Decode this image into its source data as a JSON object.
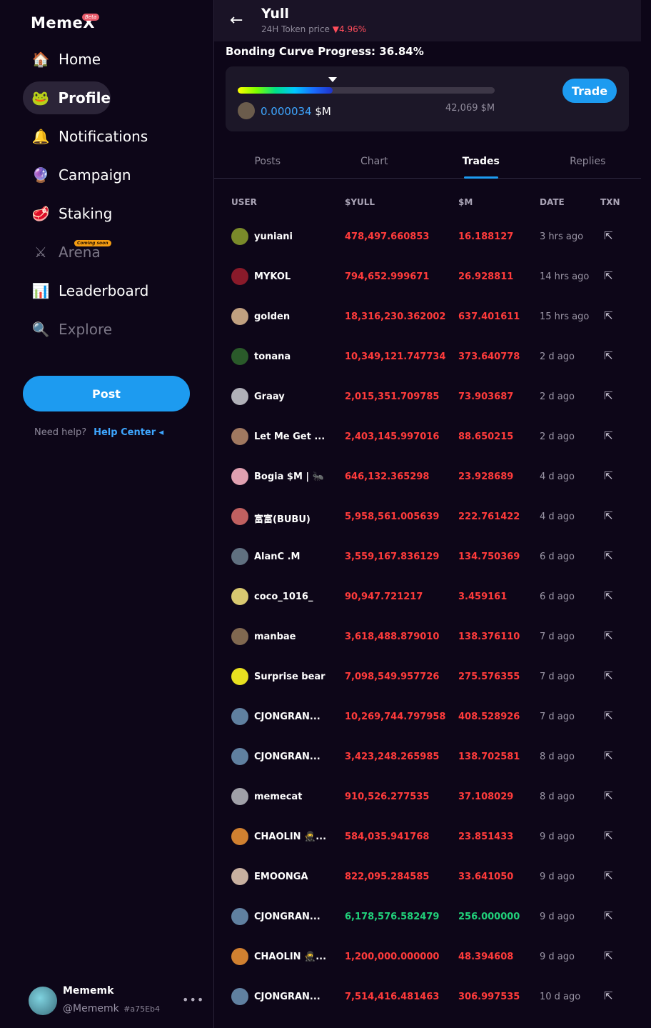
{
  "sidebar": {
    "logo": "MemeX",
    "beta": "Beta",
    "nav": [
      {
        "label": "Home",
        "icon": "🏠"
      },
      {
        "label": "Profile",
        "icon": "🐸"
      },
      {
        "label": "Notifications",
        "icon": "🔔"
      },
      {
        "label": "Campaign",
        "icon": "🔮"
      },
      {
        "label": "Staking",
        "icon": "🥩"
      },
      {
        "label": "Arena",
        "icon": "⚔",
        "badge": "Coming soon"
      },
      {
        "label": "Leaderboard",
        "icon": "📊"
      },
      {
        "label": "Explore",
        "icon": "🔍"
      }
    ],
    "post_label": "Post",
    "help_text": "Need help?",
    "help_link": "Help Center ◂",
    "user": {
      "name": "Mememk",
      "handle": "@Mememk",
      "hash": "#a75Eb4",
      "more": "•••"
    }
  },
  "header": {
    "title": "Yull",
    "price_label": "24H Token price",
    "price_change": "▼4.96%"
  },
  "bonding": {
    "title": "Bonding Curve Progress: 36.84%",
    "progress": 36.84,
    "current_value": "0.000034",
    "current_unit": " $M",
    "max_label": "42,069 $M",
    "trade_label": "Trade"
  },
  "tabs": [
    "Posts",
    "Chart",
    "Trades",
    "Replies"
  ],
  "table": {
    "headers": {
      "user": "USER",
      "amount": "$YULL",
      "m": "$M",
      "date": "DATE",
      "txn": "TXN"
    },
    "rows": [
      {
        "user": "yuniani",
        "amount": "478,497.660853",
        "m": "16.188127",
        "date": "3 hrs ago",
        "side": "sell",
        "color": "#7a8a2a"
      },
      {
        "user": "MYKOL",
        "amount": "794,652.999671",
        "m": "26.928811",
        "date": "14 hrs ago",
        "side": "sell",
        "color": "#8a1a2a"
      },
      {
        "user": "golden",
        "amount": "18,316,230.362002",
        "m": "637.401611",
        "date": "15 hrs ago",
        "side": "sell",
        "color": "#c0a080"
      },
      {
        "user": "tonana",
        "amount": "10,349,121.747734",
        "m": "373.640778",
        "date": "2 d ago",
        "side": "sell",
        "color": "#2a5a2a"
      },
      {
        "user": "Graay",
        "amount": "2,015,351.709785",
        "m": "73.903687",
        "date": "2 d ago",
        "side": "sell",
        "color": "#b0b0b8"
      },
      {
        "user": "Let Me Get ...",
        "amount": "2,403,145.997016",
        "m": "88.650215",
        "date": "2 d ago",
        "side": "sell",
        "color": "#a07860"
      },
      {
        "user": "Bogia $M | 🐜",
        "amount": "646,132.365298",
        "m": "23.928689",
        "date": "4 d ago",
        "side": "sell",
        "color": "#e0a0b0"
      },
      {
        "user": "富富(BUBU)",
        "amount": "5,958,561.005639",
        "m": "222.761422",
        "date": "4 d ago",
        "side": "sell",
        "color": "#c06060"
      },
      {
        "user": "AlanC .M",
        "amount": "3,559,167.836129",
        "m": "134.750369",
        "date": "6 d ago",
        "side": "sell",
        "color": "#607080"
      },
      {
        "user": "coco_1016_",
        "amount": "90,947.721217",
        "m": "3.459161",
        "date": "6 d ago",
        "side": "sell",
        "color": "#d8c870"
      },
      {
        "user": "manbae",
        "amount": "3,618,488.879010",
        "m": "138.376110",
        "date": "7 d ago",
        "side": "sell",
        "color": "#806850"
      },
      {
        "user": "Surprise bear",
        "amount": "7,098,549.957726",
        "m": "275.576355",
        "date": "7 d ago",
        "side": "sell",
        "color": "#e8e020"
      },
      {
        "user": "CJONGRAN...",
        "amount": "10,269,744.797958",
        "m": "408.528926",
        "date": "7 d ago",
        "side": "sell",
        "color": "#6080a0"
      },
      {
        "user": "CJONGRAN...",
        "amount": "3,423,248.265985",
        "m": "138.702581",
        "date": "8 d ago",
        "side": "sell",
        "color": "#6080a0"
      },
      {
        "user": "memecat",
        "amount": "910,526.277535",
        "m": "37.108029",
        "date": "8 d ago",
        "side": "sell",
        "color": "#a0a0a8"
      },
      {
        "user": "CHAOLIN 🥷...",
        "amount": "584,035.941768",
        "m": "23.851433",
        "date": "9 d ago",
        "side": "sell",
        "color": "#d08030"
      },
      {
        "user": "EMOONGA",
        "amount": "822,095.284585",
        "m": "33.641050",
        "date": "9 d ago",
        "side": "sell",
        "color": "#c8b0a0"
      },
      {
        "user": "CJONGRAN...",
        "amount": "6,178,576.582479",
        "m": "256.000000",
        "date": "9 d ago",
        "side": "buy",
        "color": "#6080a0"
      },
      {
        "user": "CHAOLIN 🥷...",
        "amount": "1,200,000.000000",
        "m": "48.394608",
        "date": "9 d ago",
        "side": "sell",
        "color": "#d08030"
      },
      {
        "user": "CJONGRAN...",
        "amount": "7,514,416.481463",
        "m": "306.997535",
        "date": "10 d ago",
        "side": "sell",
        "color": "#6080a0"
      }
    ],
    "txn_icon": "external-link-icon"
  }
}
